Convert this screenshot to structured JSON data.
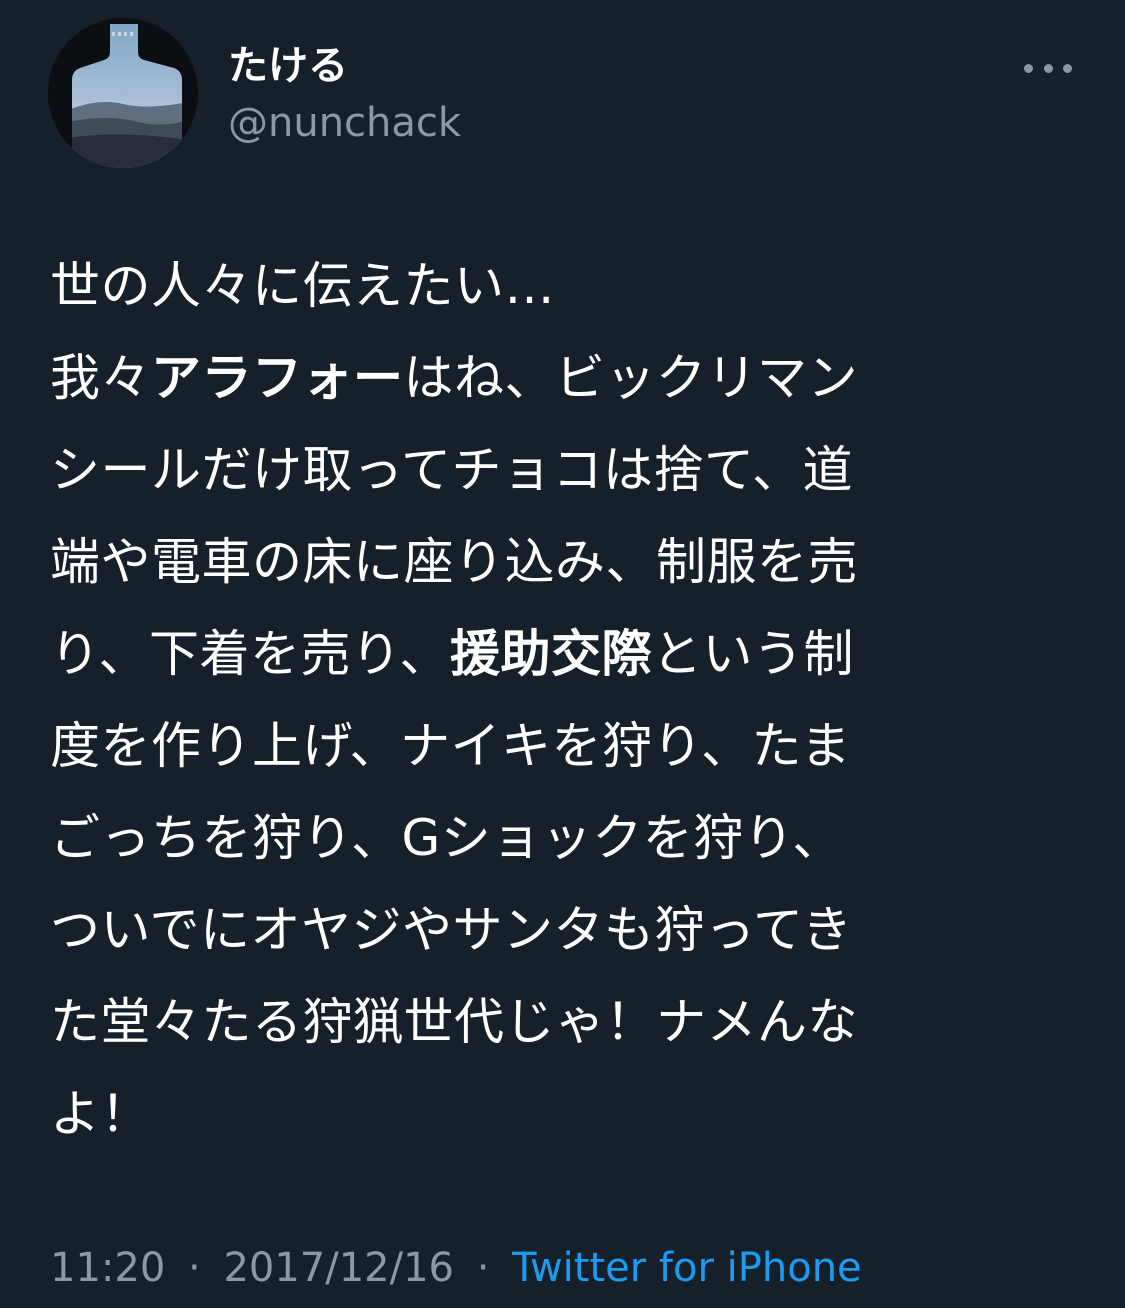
{
  "user": {
    "display_name": "たける",
    "handle": "@nunchack"
  },
  "more_icon": "more-horizontal-icon",
  "tweet": {
    "lines": [
      [
        {
          "text": "世の人々に伝えたい…",
          "bold": false
        }
      ],
      [
        {
          "text": "我々",
          "bold": false
        },
        {
          "text": "アラフォー",
          "bold": true
        },
        {
          "text": "はね、ビックリマン",
          "bold": false
        }
      ],
      [
        {
          "text": "シールだけ取ってチョコは捨て、道",
          "bold": false
        }
      ],
      [
        {
          "text": "端や電車の床に座り込み、制服を売",
          "bold": false
        }
      ],
      [
        {
          "text": "り、下着を売り、",
          "bold": false
        },
        {
          "text": "援助交際",
          "bold": true
        },
        {
          "text": "という制",
          "bold": false
        }
      ],
      [
        {
          "text": "度を作り上げ、ナイキを狩り、たま",
          "bold": false
        }
      ],
      [
        {
          "text": "ごっちを狩り、Gショックを狩り、",
          "bold": false
        }
      ],
      [
        {
          "text": "ついでにオヤジやサンタも狩ってき",
          "bold": false
        }
      ],
      [
        {
          "text": "た堂々たる狩猟世代じゃ！ナメんな",
          "bold": false
        }
      ],
      [
        {
          "text": "よ！",
          "bold": false
        }
      ]
    ]
  },
  "meta": {
    "time": "11:20",
    "separator": "·",
    "date": "2017/12/16",
    "source": "Twitter for iPhone"
  },
  "colors": {
    "background": "#15202b",
    "text": "#ffffff",
    "secondary": "#8b98a5",
    "link": "#1d9bf0"
  }
}
